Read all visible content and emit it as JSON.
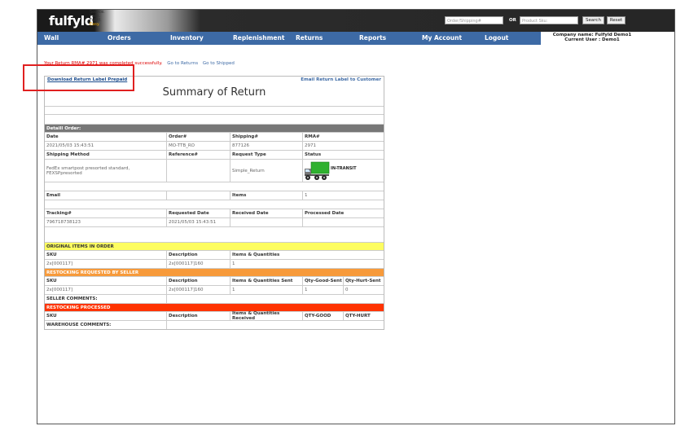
{
  "header": {
    "logo": "fulfyld",
    "tagline": [
      "Source.",
      "Pack.",
      "Fulfill."
    ],
    "tagline_easy": "Easy.",
    "search_order_placeholder": "Order/Shipping#",
    "or_label": "OR",
    "search_sku_placeholder": "Product Sku:",
    "search_button": "Search",
    "reset_button": "Reset",
    "company_line": "Company name: Fulfyld Demo1",
    "user_line": "Current User : Demo1"
  },
  "nav": [
    "Wall",
    "Orders",
    "Inventory",
    "Replenishment",
    "Returns",
    "Reports",
    "My Account",
    "Logout"
  ],
  "message": {
    "error_text": "Your Return RMA# 2971 was completed successfully.",
    "go_returns": "Go to Returns",
    "go_shipped": "Go to Shipped"
  },
  "panel": {
    "download_label": "Download Return Label Prepaid",
    "email_label": "Email Return Label to Customer",
    "title": "Summary of Return",
    "detail_header": "Detaill Order:",
    "labels": {
      "date": "Date",
      "order": "Order#",
      "shipping": "Shipping#",
      "rma": "RMA#",
      "shipping_method": "Shipping Method",
      "reference": "Reference#",
      "request_type": "Request Type",
      "status": "Status",
      "email": "Email",
      "items": "Items",
      "tracking": "Tracking#",
      "requested_date": "Requested Date",
      "received_date": "Received Date",
      "processed_date": "Processed Date"
    },
    "values": {
      "date": "2021/05/03 15:43:51",
      "order": "MO-TTB_RO",
      "shipping": "877126",
      "rma": "2971",
      "shipping_method": "FedEx smartpost presorted standard, FEXSPpresorted",
      "reference": "",
      "request_type": "Simple_Return",
      "status": "IN-TRANSIT",
      "email": "",
      "items": "1",
      "tracking": "796718738123",
      "requested_date": "2021/05/03 15:43:51",
      "received_date": "",
      "processed_date": ""
    },
    "original_header": "ORIGINAL ITEMS IN ORDER",
    "original_cols": [
      "SKU",
      "Description",
      "Items & Quantities"
    ],
    "original_row": [
      "2x[000117]",
      "2x[000117]160",
      "1"
    ],
    "restock_header": "RESTOCKING REQUESTED BY SELLER",
    "restock_cols": [
      "SKU",
      "Description",
      "Items & Quantities Sent",
      "Qty-Good-Sent",
      "Qty-Hurt-Sent"
    ],
    "restock_row": [
      "2x[000117]",
      "2x[000117]160",
      "1",
      "1",
      "0"
    ],
    "seller_comments": "SELLER COMMENTS:",
    "processed_header": "RESTOCKING PROCESSED",
    "processed_cols": [
      "SKU",
      "Description",
      "Items & Quantities Received",
      "QTY-GOOD",
      "QTY-HURT"
    ],
    "warehouse_comments": "WAREHOUSE COMMENTS:"
  },
  "colors": {
    "nav": "#3d6aa5",
    "highlight": "#e02020",
    "yellow": "#fdfd60",
    "orange": "#f79a3a",
    "red": "#ff3300"
  }
}
